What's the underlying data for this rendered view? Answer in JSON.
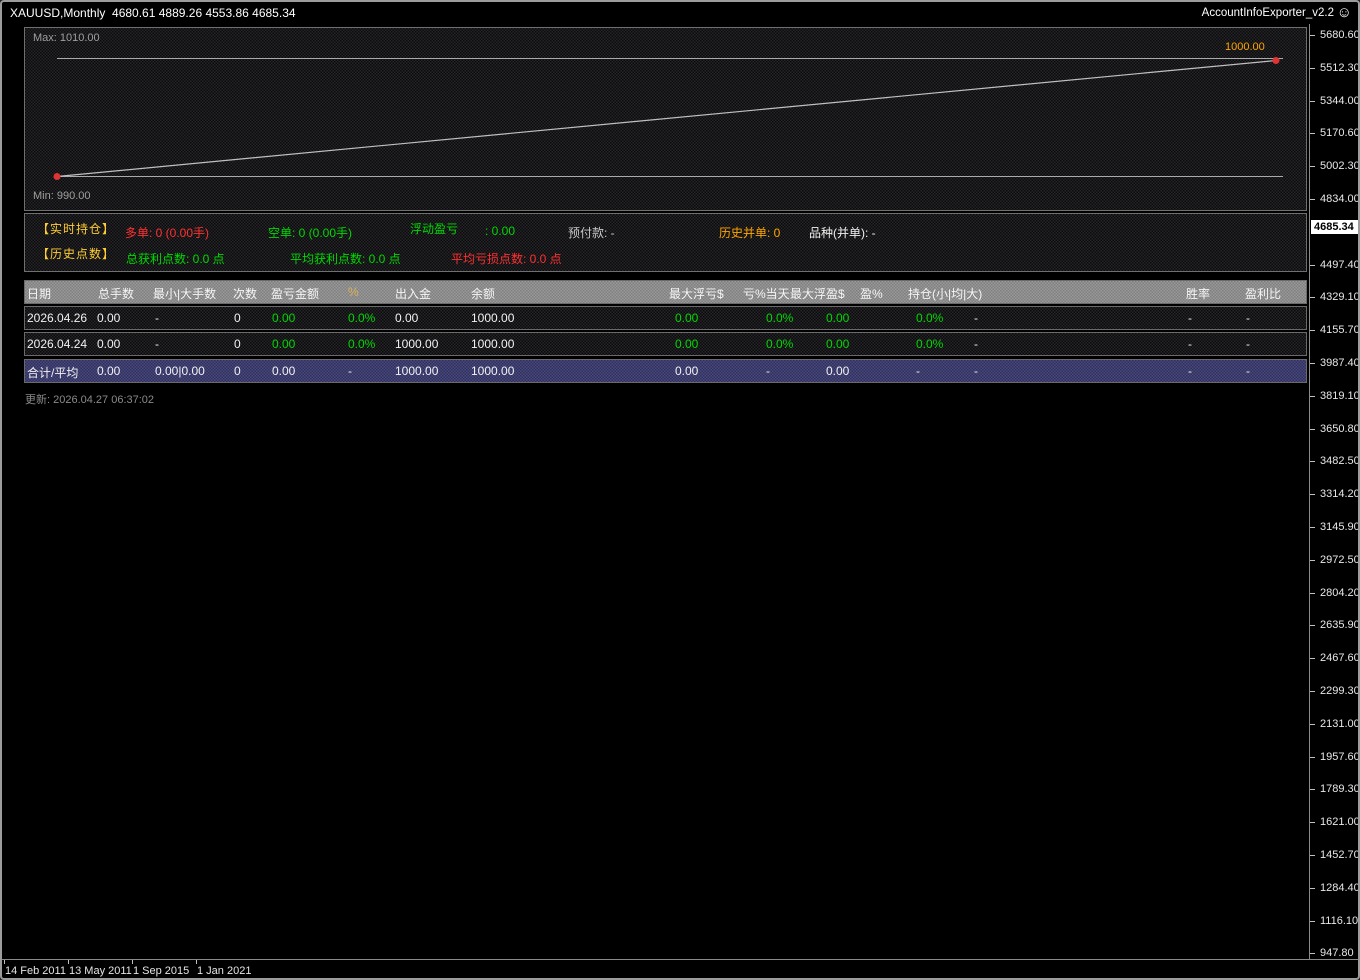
{
  "top_bar": {
    "symbol_info": "XAUUSD,Monthly  4680.61 4889.26 4553.86 4685.34",
    "indicator_name": "AccountInfoExporter_v2.2",
    "smiley_icon": "☺"
  },
  "equity_chart": {
    "max_label": "Max: 1010.00",
    "min_label": "Min: 990.00",
    "current_label": "1000.00",
    "line_color": "#b8b8b8",
    "dot_color": "#e03434"
  },
  "info_panel": {
    "row1": {
      "section_title": "【实时持仓】",
      "long_orders": "多单: 0 (0.00手)",
      "short_orders": "空单: 0 (0.00手)",
      "floating_pnl_label": "浮动盈亏",
      "floating_pnl_value": ": 0.00",
      "margin": "预付款: -",
      "history_merged": "历史并单: 0",
      "symbol_merged": "品种(并单): -"
    },
    "row2": {
      "section_title": "【历史点数】",
      "total_profit_points": "总获利点数: 0.0 点",
      "avg_profit_points": "平均获利点数: 0.0 点",
      "avg_loss_points": "平均亏损点数: 0.0 点"
    }
  },
  "table": {
    "headers": [
      "日期",
      "总手数",
      "最小|大手数",
      "次数",
      "盈亏金额",
      "%",
      "出入金",
      "余额",
      "最大浮亏$",
      "亏%当天",
      "最大浮盈$",
      "盈%",
      "持仓(小|均|大)",
      "胜率",
      "盈利比"
    ],
    "rows": [
      {
        "type": "data",
        "cells": [
          "2026.04.26",
          "0.00",
          "-",
          "0",
          "0.00",
          "0.0%",
          "0.00",
          "1000.00",
          "0.00",
          "0.0%",
          "0.00",
          "0.0%",
          "-",
          "-",
          "-"
        ],
        "colors": [
          "w",
          "w",
          "w",
          "w",
          "g",
          "g",
          "w",
          "w",
          "g",
          "g",
          "g",
          "g",
          "w",
          "w",
          "w"
        ]
      },
      {
        "type": "data",
        "cells": [
          "2026.04.24",
          "0.00",
          "-",
          "0",
          "0.00",
          "0.0%",
          "1000.00",
          "1000.00",
          "0.00",
          "0.0%",
          "0.00",
          "0.0%",
          "-",
          "-",
          "-"
        ],
        "colors": [
          "w",
          "w",
          "w",
          "w",
          "g",
          "g",
          "w",
          "w",
          "g",
          "g",
          "g",
          "g",
          "w",
          "w",
          "w"
        ]
      },
      {
        "type": "total",
        "cells": [
          "合计/平均",
          "0.00",
          "0.00|0.00",
          "0",
          "0.00",
          "-",
          "1000.00",
          "1000.00",
          "0.00",
          "-",
          "0.00",
          "-",
          "-",
          "-",
          "-"
        ],
        "colors": [
          "w",
          "w",
          "w",
          "w",
          "w",
          "w",
          "w",
          "w",
          "w",
          "w",
          "w",
          "w",
          "w",
          "w",
          "w"
        ]
      }
    ],
    "updated": "更新: 2026.04.27 06:37:02"
  },
  "price_axis": {
    "labels": [
      "5680.60",
      "5512.30",
      "5344.00",
      "5170.60",
      "5002.30",
      "4834.00",
      "4497.40",
      "4329.10",
      "4155.70",
      "3987.40",
      "3819.10",
      "3650.80",
      "3482.50",
      "3314.20",
      "3145.90",
      "2972.50",
      "2804.20",
      "2635.90",
      "2467.60",
      "2299.30",
      "2131.00",
      "1957.60",
      "1789.30",
      "1621.00",
      "1452.70",
      "1284.40",
      "1116.10",
      "947.80"
    ],
    "current_price": "4685.34"
  },
  "time_axis": {
    "labels": [
      "14 Feb 2011",
      "13 May 2011",
      "1 Sep 2015",
      "1 Jan 2021"
    ]
  },
  "colors": {
    "accent_yellow": "#ffcc33",
    "positive_green": "#00d800",
    "negative_red": "#ff3030",
    "orange": "#ffa500",
    "header_bg": "#7f7f7f",
    "total_row_bg": "#2f2f5c",
    "white_text": "#f0f0f0"
  }
}
